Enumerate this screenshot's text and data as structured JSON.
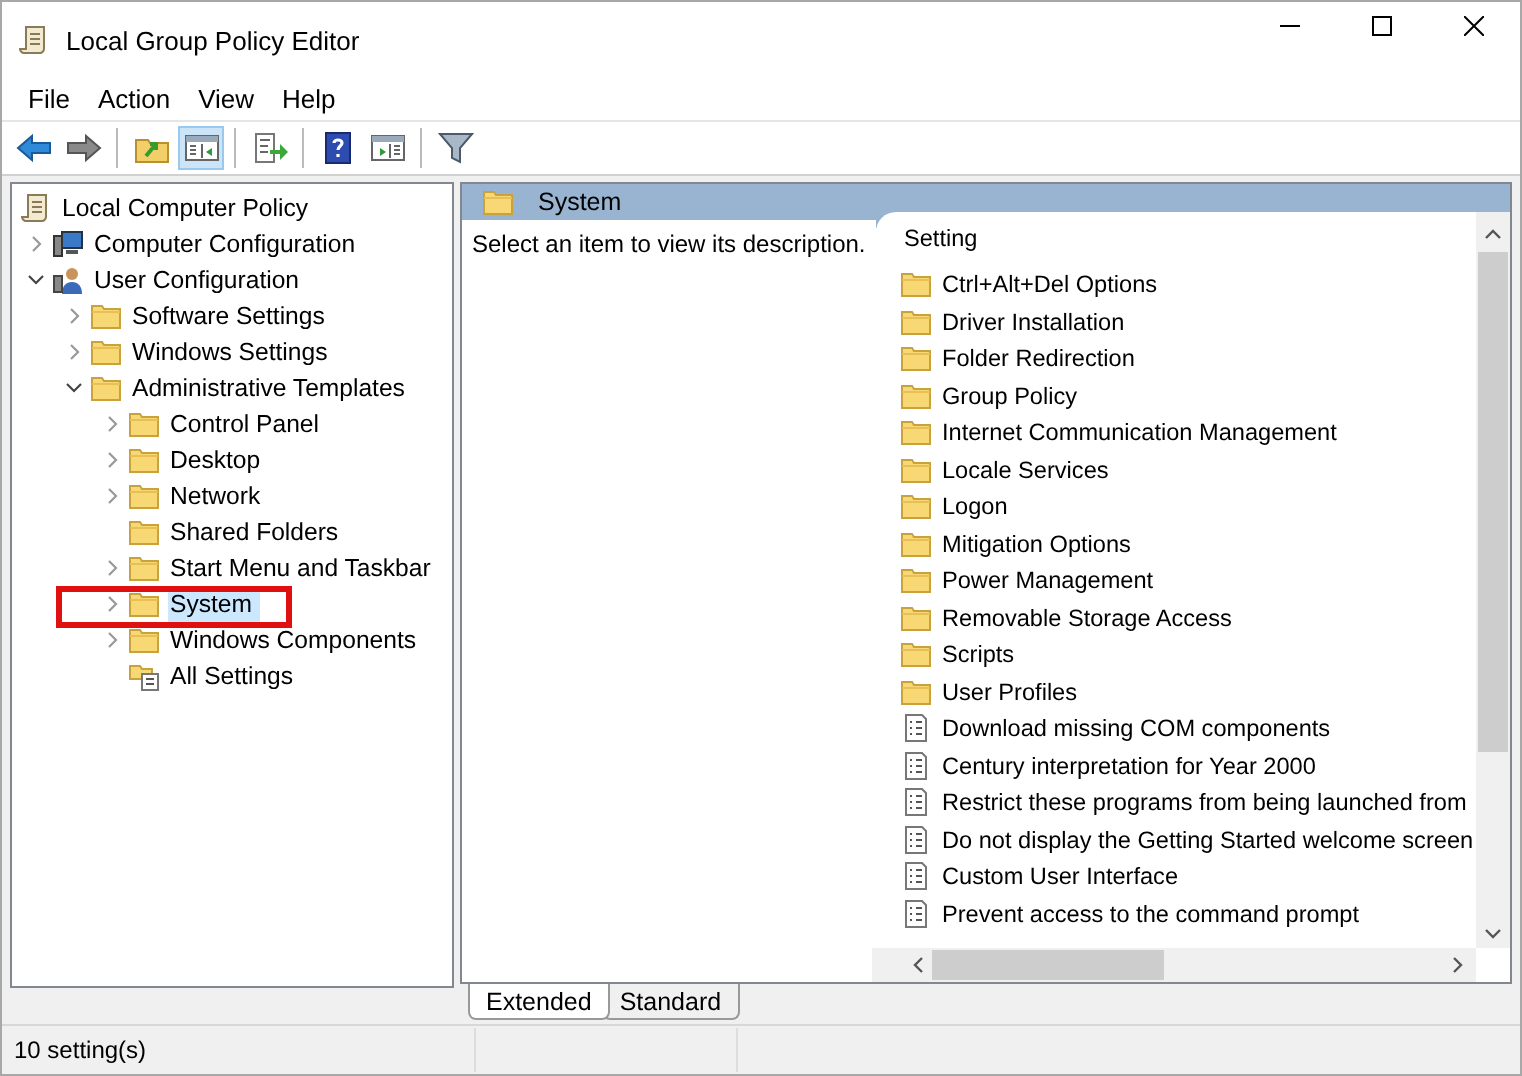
{
  "window": {
    "title": "Local Group Policy Editor"
  },
  "menu": [
    "File",
    "Action",
    "View",
    "Help"
  ],
  "tree": [
    {
      "label": "Local Computer Policy",
      "kind": "policy",
      "selected": false,
      "outlined": false,
      "children": [
        {
          "label": "Computer Configuration",
          "kind": "computer",
          "leaf": false,
          "expanded": false,
          "selected": false,
          "outlined": false
        },
        {
          "label": "User Configuration",
          "kind": "user",
          "leaf": false,
          "expanded": true,
          "selected": false,
          "outlined": false,
          "children": [
            {
              "label": "Software Settings",
              "kind": "folder",
              "leaf": false,
              "expanded": false,
              "selected": false,
              "outlined": false
            },
            {
              "label": "Windows Settings",
              "kind": "folder",
              "leaf": false,
              "expanded": false,
              "selected": false,
              "outlined": false
            },
            {
              "label": "Administrative Templates",
              "kind": "folder",
              "leaf": false,
              "expanded": true,
              "selected": false,
              "outlined": false,
              "children": [
                {
                  "label": "Control Panel",
                  "kind": "folder",
                  "leaf": false,
                  "expanded": false,
                  "selected": false,
                  "outlined": false
                },
                {
                  "label": "Desktop",
                  "kind": "folder",
                  "leaf": false,
                  "expanded": false,
                  "selected": false,
                  "outlined": false
                },
                {
                  "label": "Network",
                  "kind": "folder",
                  "leaf": false,
                  "expanded": false,
                  "selected": false,
                  "outlined": false
                },
                {
                  "label": "Shared Folders",
                  "kind": "folder",
                  "leaf": true,
                  "expanded": false,
                  "selected": false,
                  "outlined": false
                },
                {
                  "label": "Start Menu and Taskbar",
                  "kind": "folder",
                  "leaf": false,
                  "expanded": false,
                  "selected": false,
                  "outlined": false
                },
                {
                  "label": "System",
                  "kind": "folder",
                  "leaf": false,
                  "expanded": false,
                  "selected": true,
                  "outlined": true
                },
                {
                  "label": "Windows Components",
                  "kind": "folder",
                  "leaf": false,
                  "expanded": false,
                  "selected": false,
                  "outlined": false
                },
                {
                  "label": "All Settings",
                  "kind": "allsettings",
                  "leaf": true,
                  "expanded": false,
                  "selected": false,
                  "outlined": false
                }
              ]
            }
          ]
        }
      ]
    }
  ],
  "details": {
    "title": "System",
    "description": "Select an item to view its description.",
    "column": "Setting",
    "rows": [
      {
        "label": "Ctrl+Alt+Del Options",
        "kind": "folder"
      },
      {
        "label": "Driver Installation",
        "kind": "folder"
      },
      {
        "label": "Folder Redirection",
        "kind": "folder"
      },
      {
        "label": "Group Policy",
        "kind": "folder"
      },
      {
        "label": "Internet Communication Management",
        "kind": "folder"
      },
      {
        "label": "Locale Services",
        "kind": "folder"
      },
      {
        "label": "Logon",
        "kind": "folder"
      },
      {
        "label": "Mitigation Options",
        "kind": "folder"
      },
      {
        "label": "Power Management",
        "kind": "folder"
      },
      {
        "label": "Removable Storage Access",
        "kind": "folder"
      },
      {
        "label": "Scripts",
        "kind": "folder"
      },
      {
        "label": "User Profiles",
        "kind": "folder"
      },
      {
        "label": "Download missing COM components",
        "kind": "policy"
      },
      {
        "label": "Century interpretation for Year 2000",
        "kind": "policy"
      },
      {
        "label": "Restrict these programs from being launched from",
        "kind": "policy"
      },
      {
        "label": "Do not display the Getting Started welcome screen",
        "kind": "policy"
      },
      {
        "label": "Custom User Interface",
        "kind": "policy"
      },
      {
        "label": "Prevent access to the command prompt",
        "kind": "policy"
      }
    ]
  },
  "view_tabs": [
    {
      "label": "Extended",
      "selected": true
    },
    {
      "label": "Standard",
      "selected": false
    }
  ],
  "status_bar": {
    "text": "10 setting(s)"
  }
}
